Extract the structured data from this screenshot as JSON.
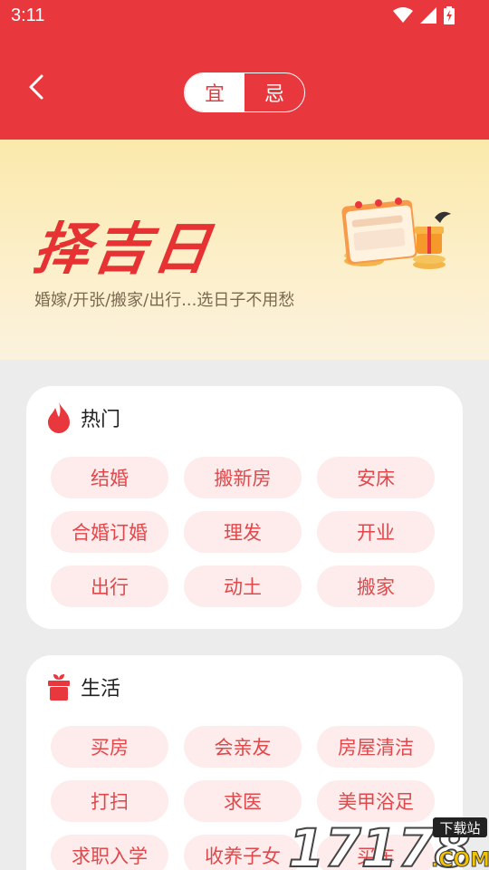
{
  "status_bar": {
    "time": "3:11"
  },
  "header": {
    "toggle": {
      "yi_label": "宜",
      "ji_label": "忌",
      "selected": "宜"
    }
  },
  "banner": {
    "title": "择吉日",
    "subtitle": "婚嫁/开张/搬家/出行...选日子不用愁"
  },
  "hot": {
    "title": "热门",
    "items": [
      "结婚",
      "搬新房",
      "安床",
      "合婚订婚",
      "理发",
      "开业",
      "出行",
      "动土",
      "搬家"
    ]
  },
  "life": {
    "title": "生活",
    "items": [
      "买房",
      "会亲友",
      "房屋清洁",
      "打扫",
      "求医",
      "美甲浴足",
      "求职入学",
      "收养子女",
      "买车"
    ]
  },
  "watermark": {
    "text": "17178",
    "badge": "下载站",
    "suffix": ".COM"
  },
  "colors": {
    "accent": "#e8383d",
    "chip_bg": "#fdeceb",
    "chip_text": "#e0484b"
  }
}
